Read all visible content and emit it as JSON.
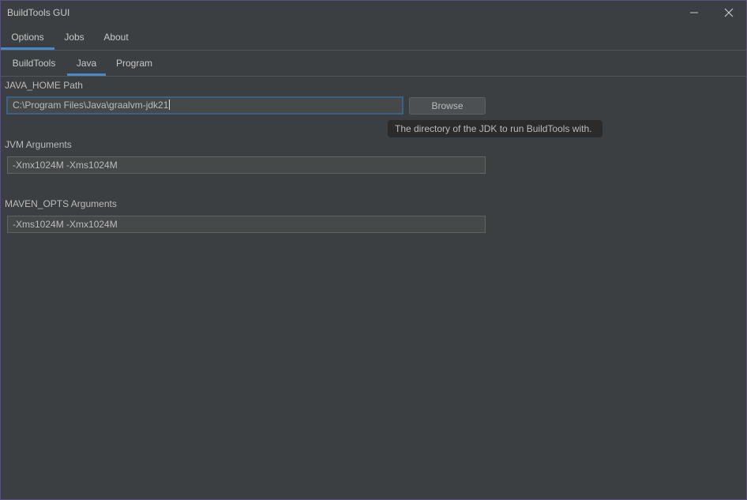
{
  "window": {
    "title": "BuildTools GUI"
  },
  "main_tabs": [
    {
      "label": "Options",
      "active": true
    },
    {
      "label": "Jobs",
      "active": false
    },
    {
      "label": "About",
      "active": false
    }
  ],
  "sub_tabs": [
    {
      "label": "BuildTools",
      "active": false
    },
    {
      "label": "Java",
      "active": true
    },
    {
      "label": "Program",
      "active": false
    }
  ],
  "java": {
    "java_home_label": "JAVA_HOME Path",
    "java_home_value": "C:\\Program Files\\Java\\graalvm-jdk21",
    "browse_label": "Browse",
    "tooltip": "The directory of the JDK to run BuildTools with.",
    "jvm_label": "JVM Arguments",
    "jvm_value": "-Xmx1024M -Xms1024M",
    "maven_label": "MAVEN_OPTS Arguments",
    "maven_value": "-Xms1024M -Xmx1024M"
  },
  "colors": {
    "background": "#3c3f41",
    "accent": "#4a88c7",
    "border": "#5a4f82"
  }
}
